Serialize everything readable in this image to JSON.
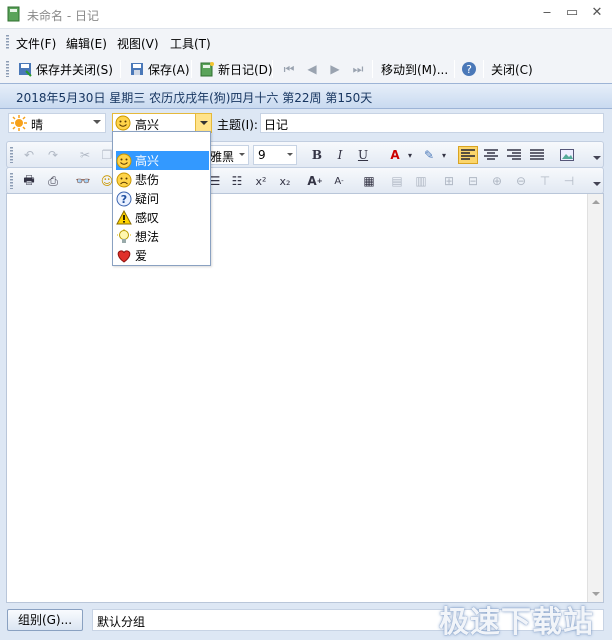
{
  "window": {
    "title": "未命名 - 日记",
    "controls": [
      "minimize",
      "maximize",
      "close"
    ]
  },
  "menu": {
    "items": [
      "文件(F)",
      "编辑(E)",
      "视图(V)",
      "工具(T)"
    ]
  },
  "toolbar": {
    "save_close": "保存并关闭(S)",
    "save": "保存(A)",
    "new_diary": "新日记(D)",
    "move_to": "移动到(M)...",
    "close": "关闭(C)"
  },
  "date_banner": {
    "text": "2018年5月30日  星期三  农历戊戌年(狗)四月十六   第22周  第150天"
  },
  "fields": {
    "weather": "晴",
    "mood": "高兴",
    "subject_label": "主题(I):",
    "subject_value": "日记"
  },
  "format": {
    "font_name_partial": "雅黑",
    "font_size": "9"
  },
  "mood_dropdown": {
    "items": [
      {
        "label": "高兴",
        "icon": "happy-face-icon",
        "selected": true
      },
      {
        "label": "悲伤",
        "icon": "sad-face-icon",
        "selected": false
      },
      {
        "label": "疑问",
        "icon": "question-icon",
        "selected": false
      },
      {
        "label": "感叹",
        "icon": "warning-icon",
        "selected": false
      },
      {
        "label": "想法",
        "icon": "lightbulb-icon",
        "selected": false
      },
      {
        "label": "爱",
        "icon": "heart-icon",
        "selected": false
      }
    ]
  },
  "status": {
    "group_button": "组别(G)...",
    "group_value": "默认分组"
  },
  "watermark": "极速下载站",
  "colors": {
    "accent": "#3399ff",
    "banner_text": "#15345f",
    "active_button": "#fbd56b"
  }
}
